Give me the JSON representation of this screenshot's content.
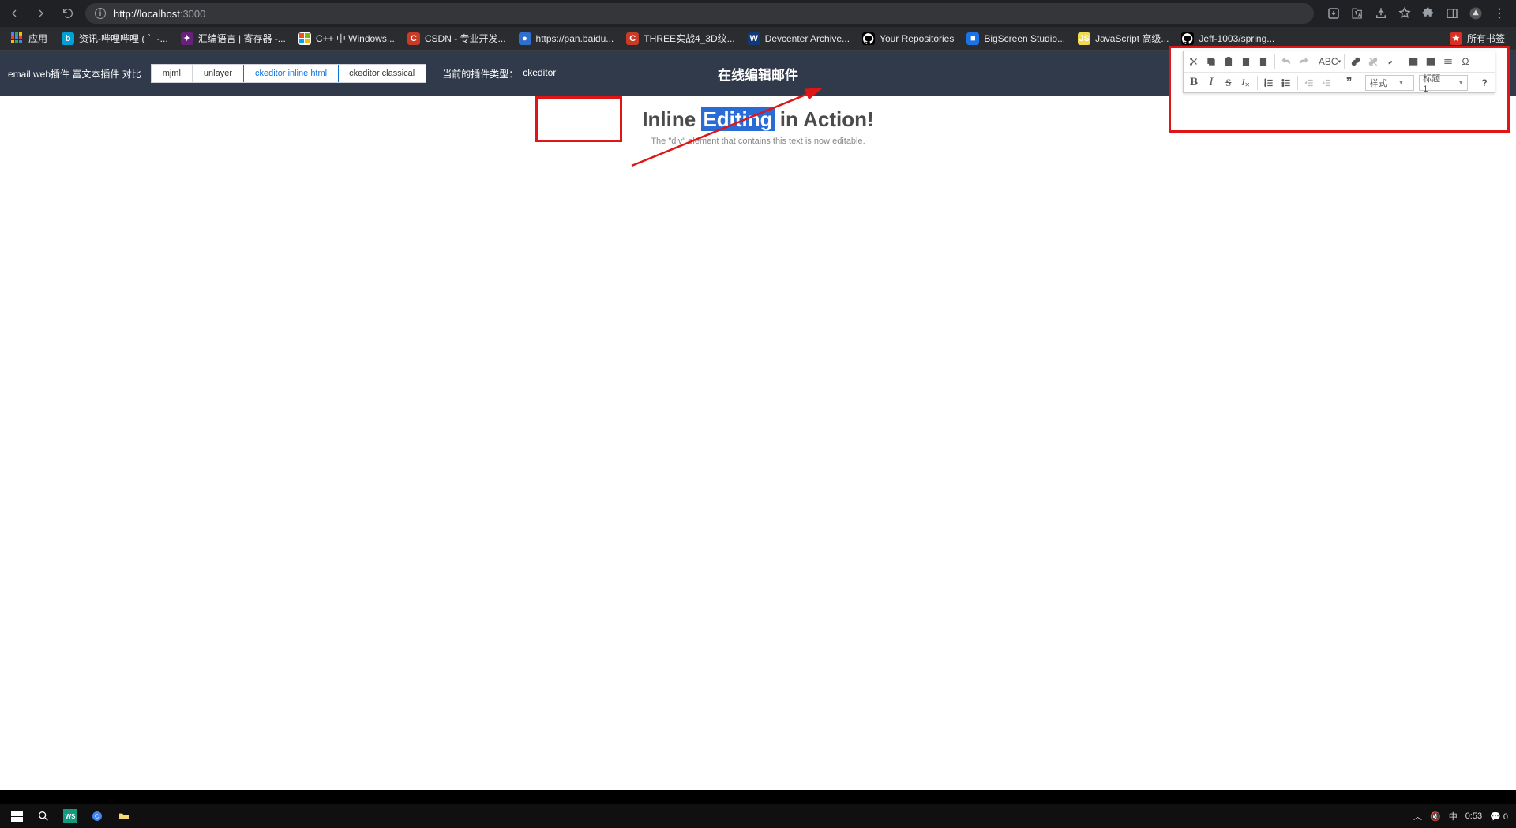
{
  "browser": {
    "url_host": "localhost",
    "url_port": ":3000",
    "url_prefix": "http://"
  },
  "bookmarks": {
    "apps": "应用",
    "items": [
      {
        "label": "资讯-哔哩哔哩 ( ゜-...",
        "bg": "#00a1d6",
        "txt": "b"
      },
      {
        "label": "汇编语言 | 寄存器 -...",
        "bg": "#68217a",
        "txt": "✦"
      },
      {
        "label": "C++ 中 Windows...",
        "bg": "#fff",
        "txt": ""
      },
      {
        "label": "CSDN - 专业开发...",
        "bg": "#ca3b27",
        "txt": "C"
      },
      {
        "label": "https://pan.baidu...",
        "bg": "#2f6fd0",
        "txt": "●"
      },
      {
        "label": "THREE实战4_3D纹...",
        "bg": "#ca3b27",
        "txt": "C"
      },
      {
        "label": "Devcenter Archive...",
        "bg": "#0f3a7a",
        "txt": "W"
      },
      {
        "label": "Your Repositories",
        "bg": "#000",
        "txt": "gh"
      },
      {
        "label": "BigScreen Studio...",
        "bg": "#1a73e8",
        "txt": "■"
      },
      {
        "label": "JavaScript 高级...",
        "bg": "#f0db4f",
        "txt": "JS"
      },
      {
        "label": "Jeff-1003/spring...",
        "bg": "#000",
        "txt": "gh"
      }
    ],
    "more": "所有书签"
  },
  "pagebar": {
    "compare_label": "email web插件 富文本插件 对比",
    "tabs": [
      "mjml",
      "unlayer",
      "ckeditor inline html",
      "ckeditor classical"
    ],
    "active_tab": 2,
    "current_label": "当前的插件类型：",
    "current_value": "ckeditor",
    "title": "在线编辑邮件"
  },
  "content": {
    "h_pre": "Inline ",
    "h_sel": "Editing",
    "h_post": " in Action!",
    "sub": "The \"div\" element that contains this text is now editable."
  },
  "ck": {
    "style_label": "样式",
    "format_label": "标题 1"
  },
  "taskbar": {
    "ime": "中",
    "time": "0:53",
    "tray_count": "0"
  }
}
